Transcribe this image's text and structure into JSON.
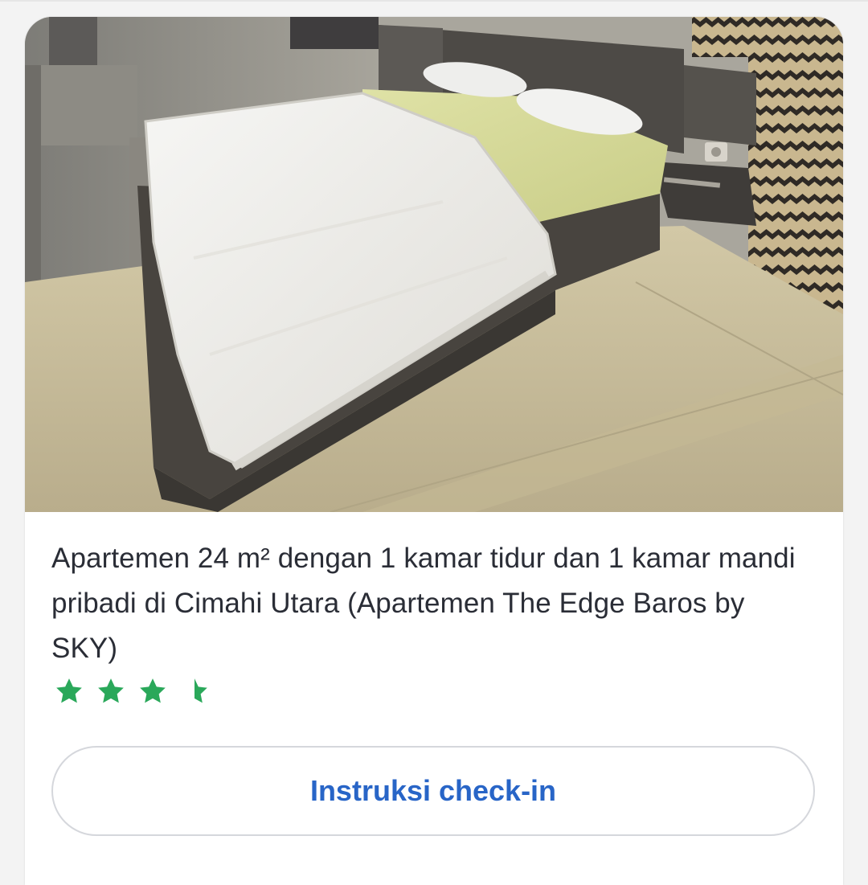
{
  "listing": {
    "photo_alt": "Kamar tidur apartemen",
    "title": "Apartemen 24 m² dengan 1 kamar tidur dan 1 kamar mandi pribadi di Cimahi Utara (Apartemen The Edge Baros by SKY)",
    "rating": 3.5,
    "rating_max": 5,
    "star_color": "#2aa85a"
  },
  "actions": {
    "checkin_label": "Instruksi check-in"
  }
}
